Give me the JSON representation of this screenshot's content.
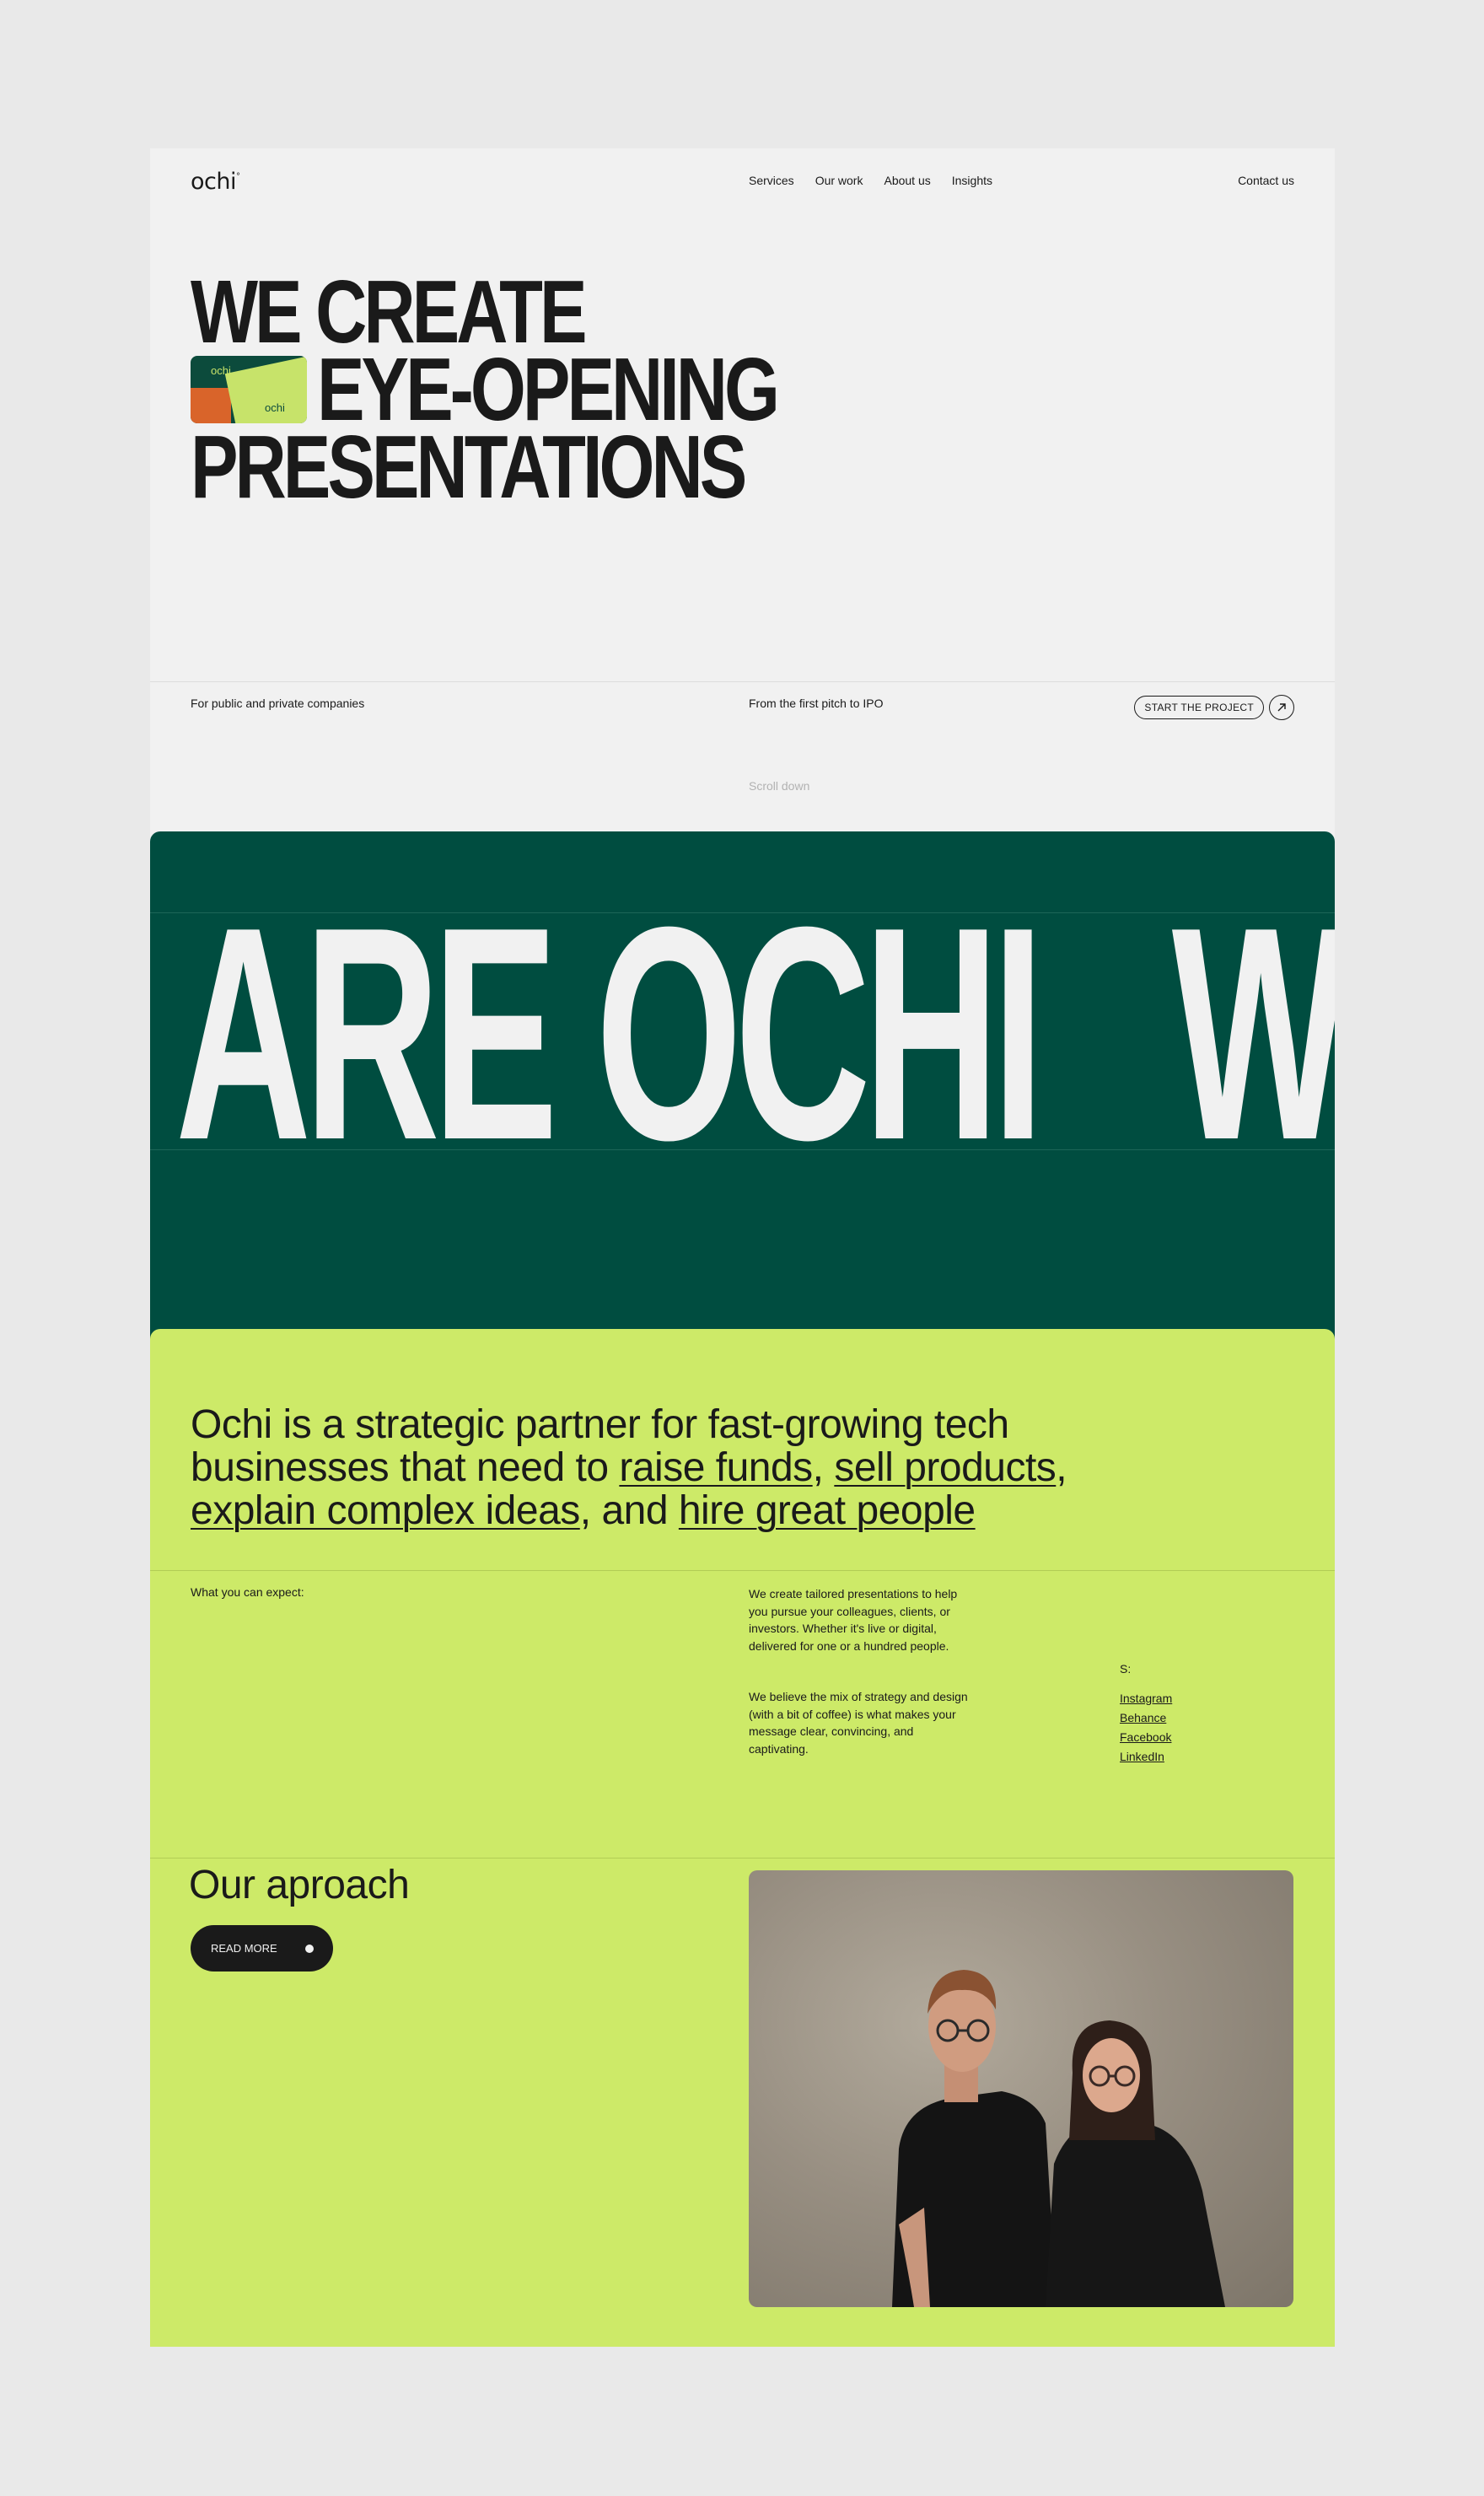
{
  "nav": {
    "logo": "ochi",
    "logo_mark": "°",
    "links": [
      "Services",
      "Our work",
      "About us",
      "Insights"
    ],
    "contact": "Contact us"
  },
  "hero": {
    "line1": "WE CREATE",
    "line2": "EYE-OPENING",
    "line3": "PRESENTATIONS",
    "thumb_text": "ochi",
    "tag_left": "For public and private companies",
    "tag_mid": "From the first pitch to IPO",
    "cta": "START THE PROJECT",
    "cta_icon": "arrow-up-right-icon",
    "scroll": "Scroll down"
  },
  "marquee": {
    "text": "ARE OCHI   WE"
  },
  "about": {
    "intro": "Ochi is a strategic partner for fast-growing tech businesses that need to ",
    "link1": "raise funds",
    "sep1": ", ",
    "link2": "sell products",
    "sep2": ", ",
    "link3": "explain complex ideas",
    "sep3": ", and ",
    "link4": "hire great people",
    "expect_label": "What you can expect:",
    "para1": "We create tailored presentations to help you pursue your colleagues, clients, or investors. Whether it's live or digital, delivered for one or a hundred people.",
    "para2": "We believe the mix of strategy and design (with a bit of coffee) is what makes your message clear, convincing, and captivating.",
    "socials_label": "S:",
    "socials": [
      "Instagram",
      "Behance",
      "Facebook",
      "LinkedIn"
    ]
  },
  "approach": {
    "title": "Our aproach",
    "button": "READ MORE"
  },
  "colors": {
    "page_bg": "#e9e9e9",
    "surface": "#f1f1f1",
    "dark_green": "#004d40",
    "lime": "#cdea68",
    "ink": "#1a1a1a"
  }
}
